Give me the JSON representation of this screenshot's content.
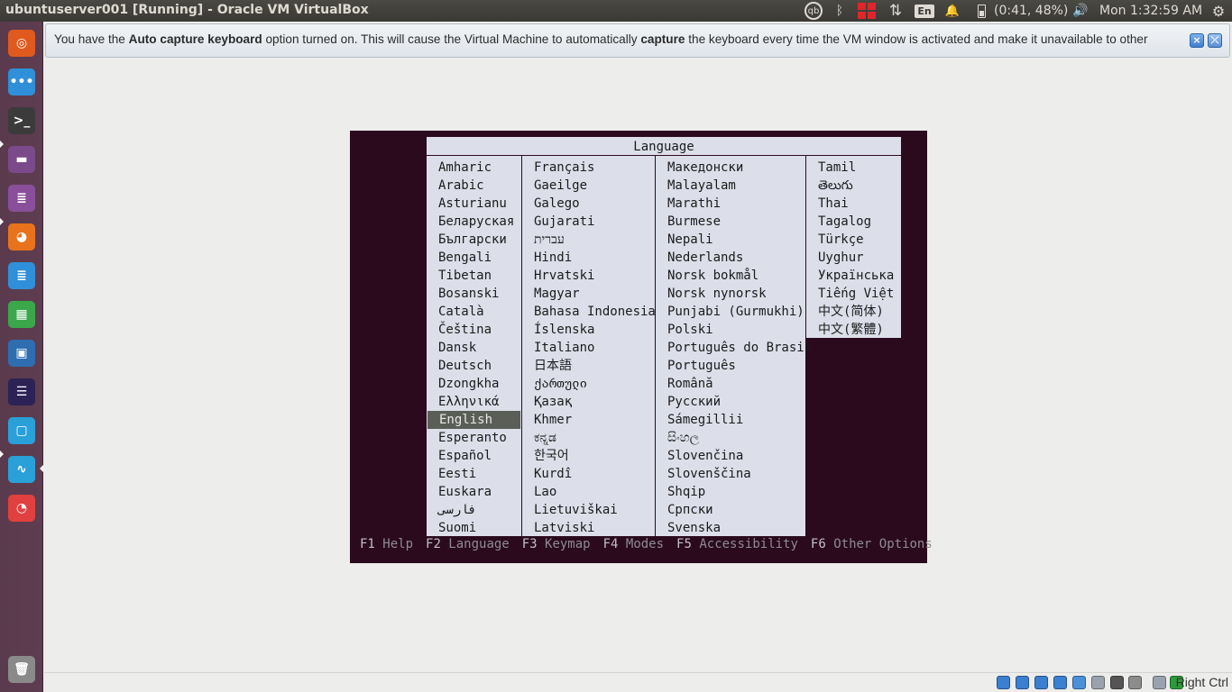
{
  "top_panel": {
    "window_title": "ubuntuserver001 [Running] - Oracle VM VirtualBox",
    "indicators": [
      {
        "name": "qb-icon",
        "glyph": "qb"
      },
      {
        "name": "bluetooth-icon",
        "glyph": "ᛒ"
      },
      {
        "name": "workspaces-icon",
        "glyph": ""
      },
      {
        "name": "network-arrows-icon",
        "glyph": "⇅"
      },
      {
        "name": "keyboard-layout-indicator",
        "glyph": "En"
      },
      {
        "name": "notification-bell-icon",
        "glyph": "🔔"
      },
      {
        "name": "battery-icon",
        "glyph": "▮"
      }
    ],
    "battery_text": "(0:41, 48%)",
    "volume_glyph": "🔊",
    "clock": "Mon  1:32:59 AM",
    "gear_glyph": "⚙"
  },
  "launcher": {
    "items": [
      {
        "name": "ubuntu-dash-icon",
        "glyph": "◎",
        "bg": "#e05a1f"
      },
      {
        "name": "apps-icon",
        "glyph": "•••",
        "bg": "#2f8fd8"
      },
      {
        "name": "terminal-icon",
        "glyph": ">_",
        "bg": "#3b3b3b"
      },
      {
        "name": "files-icon",
        "glyph": "▬",
        "bg": "#7b4a8a"
      },
      {
        "name": "text-editor-icon",
        "glyph": "≣",
        "bg": "#8a4f9a"
      },
      {
        "name": "firefox-icon",
        "glyph": "◕",
        "bg": "#e8731c"
      },
      {
        "name": "writer-icon",
        "glyph": "≣",
        "bg": "#2f8fd8"
      },
      {
        "name": "calc-icon",
        "glyph": "▦",
        "bg": "#3aa84a"
      },
      {
        "name": "virtualbox-icon",
        "glyph": "▣",
        "bg": "#2e6db0"
      },
      {
        "name": "eclipse-icon",
        "glyph": "☰",
        "bg": "#2c2255"
      },
      {
        "name": "screenshot-icon",
        "glyph": "▢",
        "bg": "#2aa0d8"
      },
      {
        "name": "system-monitor-icon",
        "glyph": "∿",
        "bg": "#2aa0d8"
      },
      {
        "name": "disk-usage-icon",
        "glyph": "◔",
        "bg": "#e04040"
      }
    ],
    "trash": {
      "name": "trash-icon",
      "glyph": "🗑"
    }
  },
  "notice": {
    "part1": "You have the ",
    "bold1": "Auto capture keyboard",
    "part2": " option turned on. This will cause the Virtual Machine to automatically ",
    "bold2": "capture",
    "part3": " the keyboard every time the VM window is activated and make it unavailable to other"
  },
  "installer": {
    "title": "Language",
    "columns": [
      [
        "Amharic",
        "Arabic",
        "Asturianu",
        "Беларуская",
        "Български",
        "Bengali",
        "Tibetan",
        "Bosanski",
        "Català",
        "Čeština",
        "Dansk",
        "Deutsch",
        "Dzongkha",
        "Ελληνικά",
        "English",
        "Esperanto",
        "Español",
        "Eesti",
        "Euskara",
        "فارسی",
        "Suomi"
      ],
      [
        "Français",
        "Gaeilge",
        "Galego",
        "Gujarati",
        "עברית",
        "Hindi",
        "Hrvatski",
        "Magyar",
        "Bahasa Indonesia",
        "Íslenska",
        "Italiano",
        "日本語",
        "ქართული",
        "Қазақ",
        "Khmer",
        "ಕನ್ನಡ",
        "한국어",
        "Kurdî",
        "Lao",
        "Lietuviškai",
        "Latviski"
      ],
      [
        "Македонски",
        "Malayalam",
        "Marathi",
        "Burmese",
        "Nepali",
        "Nederlands",
        "Norsk bokmål",
        "Norsk nynorsk",
        "Punjabi (Gurmukhi)",
        "Polski",
        "Português do Brasil",
        "Português",
        "Română",
        "Русский",
        "Sámegillii",
        "සිංහල",
        "Slovenčina",
        "Slovenščina",
        "Shqip",
        "Српски",
        "Svenska"
      ],
      [
        "Tamil",
        "తెలుగు",
        "Thai",
        "Tagalog",
        "Türkçe",
        "Uyghur",
        "Українська",
        "Tiếng Việt",
        "中文(简体)",
        "中文(繁體)"
      ]
    ],
    "selected": "English",
    "fkeys": [
      {
        "key": "F1",
        "label": "Help"
      },
      {
        "key": "F2",
        "label": "Language"
      },
      {
        "key": "F3",
        "label": "Keymap"
      },
      {
        "key": "F4",
        "label": "Modes"
      },
      {
        "key": "F5",
        "label": "Accessibility"
      },
      {
        "key": "F6",
        "label": "Other Options"
      }
    ]
  },
  "status_bar": {
    "icons": [
      "hard-disk-icon",
      "optical-drive-icon",
      "audio-icon",
      "network-icon",
      "usb-icon",
      "shared-folders-icon",
      "display-icon",
      "video-capture-icon",
      "mouse-integration-icon",
      "keyboard-capture-icon"
    ],
    "host_key": "Right Ctrl"
  },
  "colors": {
    "vm_background": "#2b0a1e",
    "menu_background": "#dcdfe9",
    "selection": "#5b5e57"
  }
}
